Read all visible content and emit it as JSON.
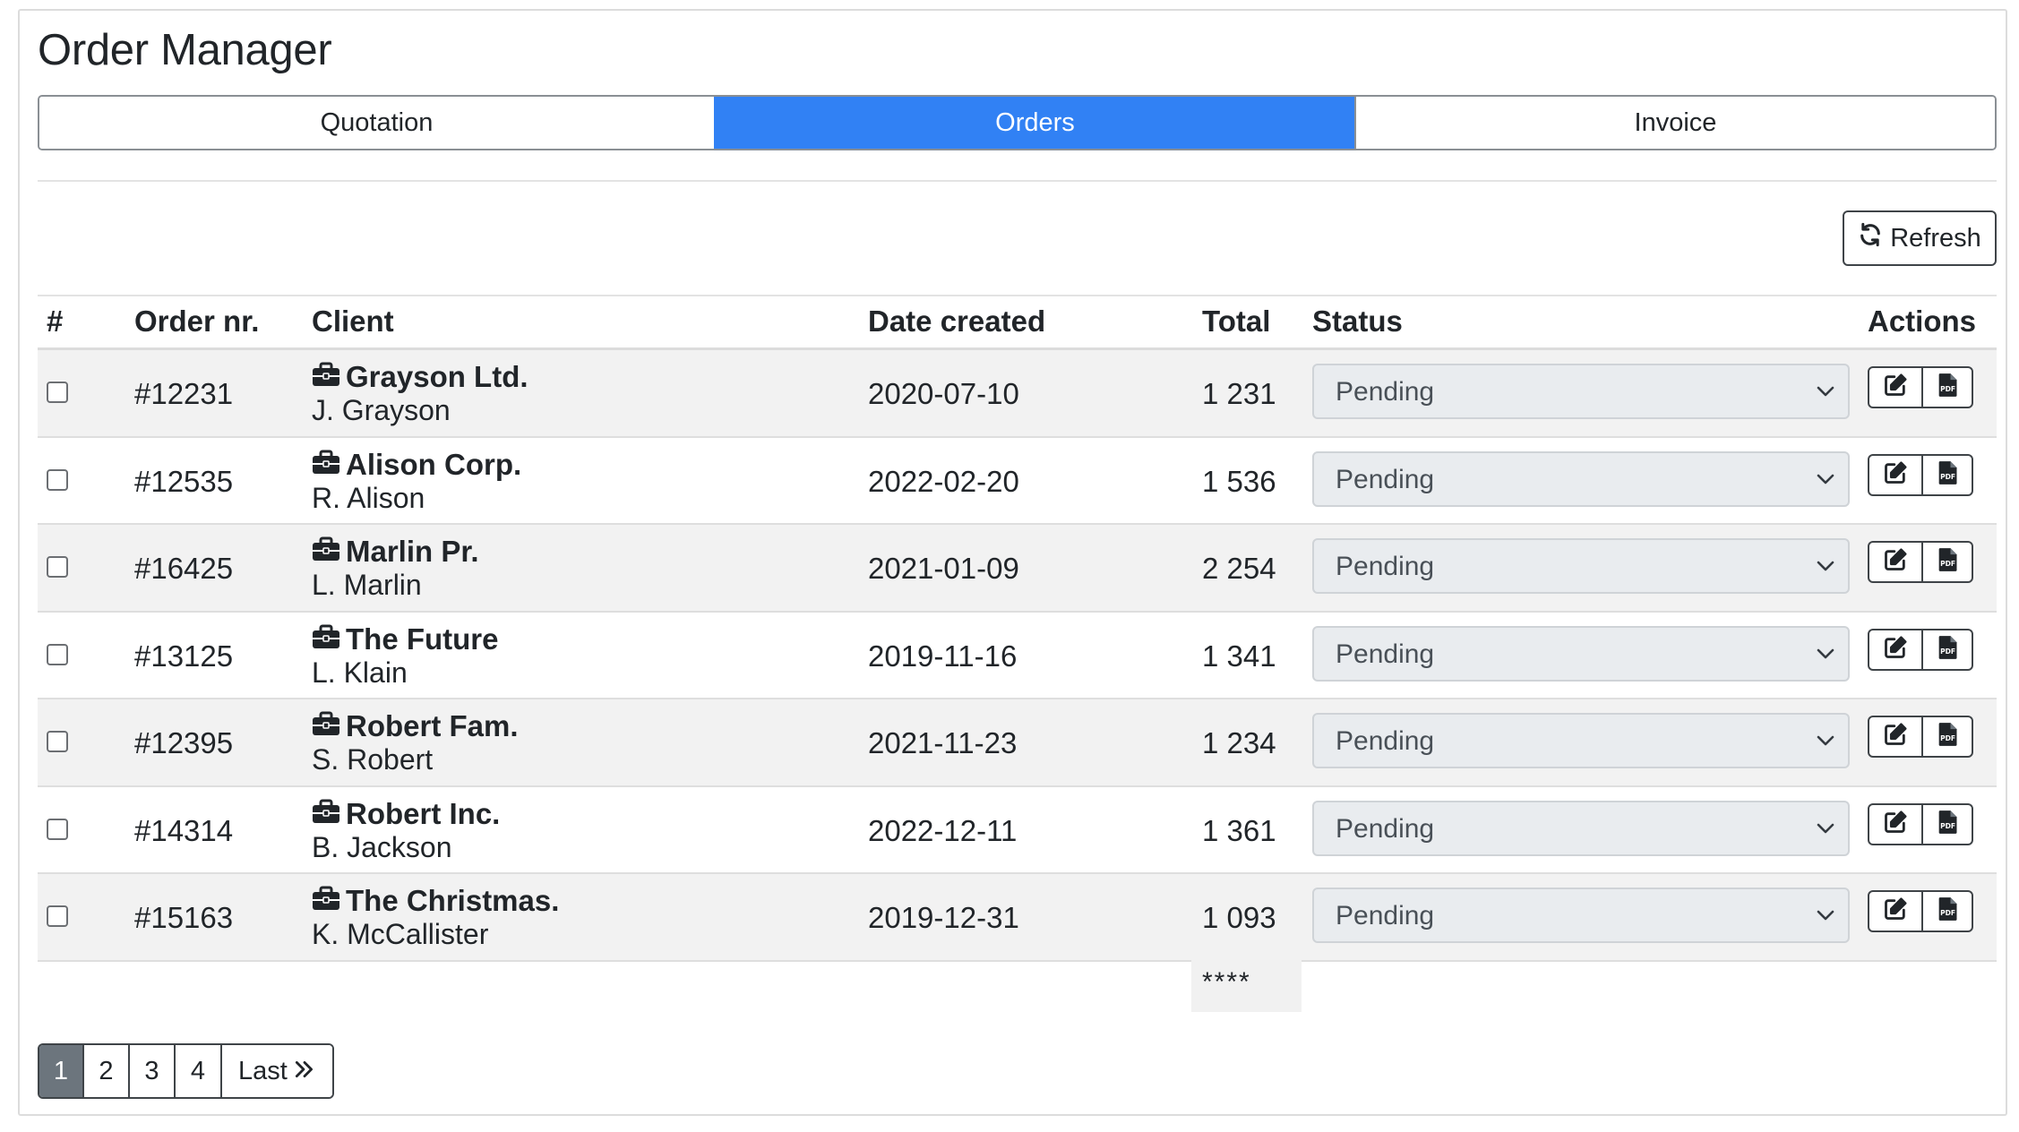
{
  "page": {
    "title": "Order Manager"
  },
  "tabs": [
    {
      "label": "Quotation",
      "active": false
    },
    {
      "label": "Orders",
      "active": true
    },
    {
      "label": "Invoice",
      "active": false
    }
  ],
  "toolbar": {
    "refresh_label": "Refresh",
    "refresh_icon": "refresh-icon"
  },
  "table": {
    "headers": {
      "select": "#",
      "order_nr": "Order nr.",
      "client": "Client",
      "date_created": "Date created",
      "total": "Total",
      "status": "Status",
      "actions": "Actions"
    },
    "rows": [
      {
        "order": "#12231",
        "company": "Grayson Ltd.",
        "contact": "J. Grayson",
        "date": "2020-07-10",
        "total": "1 231",
        "status": "Pending",
        "checked": false
      },
      {
        "order": "#12535",
        "company": "Alison Corp.",
        "contact": "R. Alison",
        "date": "2022-02-20",
        "total": "1 536",
        "status": "Pending",
        "checked": false
      },
      {
        "order": "#16425",
        "company": "Marlin Pr.",
        "contact": "L. Marlin",
        "date": "2021-01-09",
        "total": "2 254",
        "status": "Pending",
        "checked": false
      },
      {
        "order": "#13125",
        "company": "The Future",
        "contact": "L. Klain",
        "date": "2019-11-16",
        "total": "1 341",
        "status": "Pending",
        "checked": false
      },
      {
        "order": "#12395",
        "company": "Robert Fam.",
        "contact": "S. Robert",
        "date": "2021-11-23",
        "total": "1 234",
        "status": "Pending",
        "checked": false
      },
      {
        "order": "#14314",
        "company": "Robert Inc.",
        "contact": "B. Jackson",
        "date": "2022-12-11",
        "total": "1 361",
        "status": "Pending",
        "checked": false
      },
      {
        "order": "#15163",
        "company": "The Christmas.",
        "contact": "K. McCallister",
        "date": "2019-12-31",
        "total": "1 093",
        "status": "Pending",
        "checked": false
      }
    ],
    "footer_total": "****"
  },
  "pagination": {
    "pages": [
      "1",
      "2",
      "3",
      "4"
    ],
    "active_page": "1",
    "last_label": "Last"
  },
  "icons": {
    "client": "briefcase-icon",
    "edit": "edit-icon",
    "pdf": "pdf-file-icon",
    "select_arrow": "chevron-down-icon",
    "last": "double-chevron-right-icon"
  },
  "colors": {
    "accent": "#3181f4",
    "active_page": "#6c757d",
    "row_stripe": "#f2f2f2",
    "select_bg": "#e9ecef"
  }
}
